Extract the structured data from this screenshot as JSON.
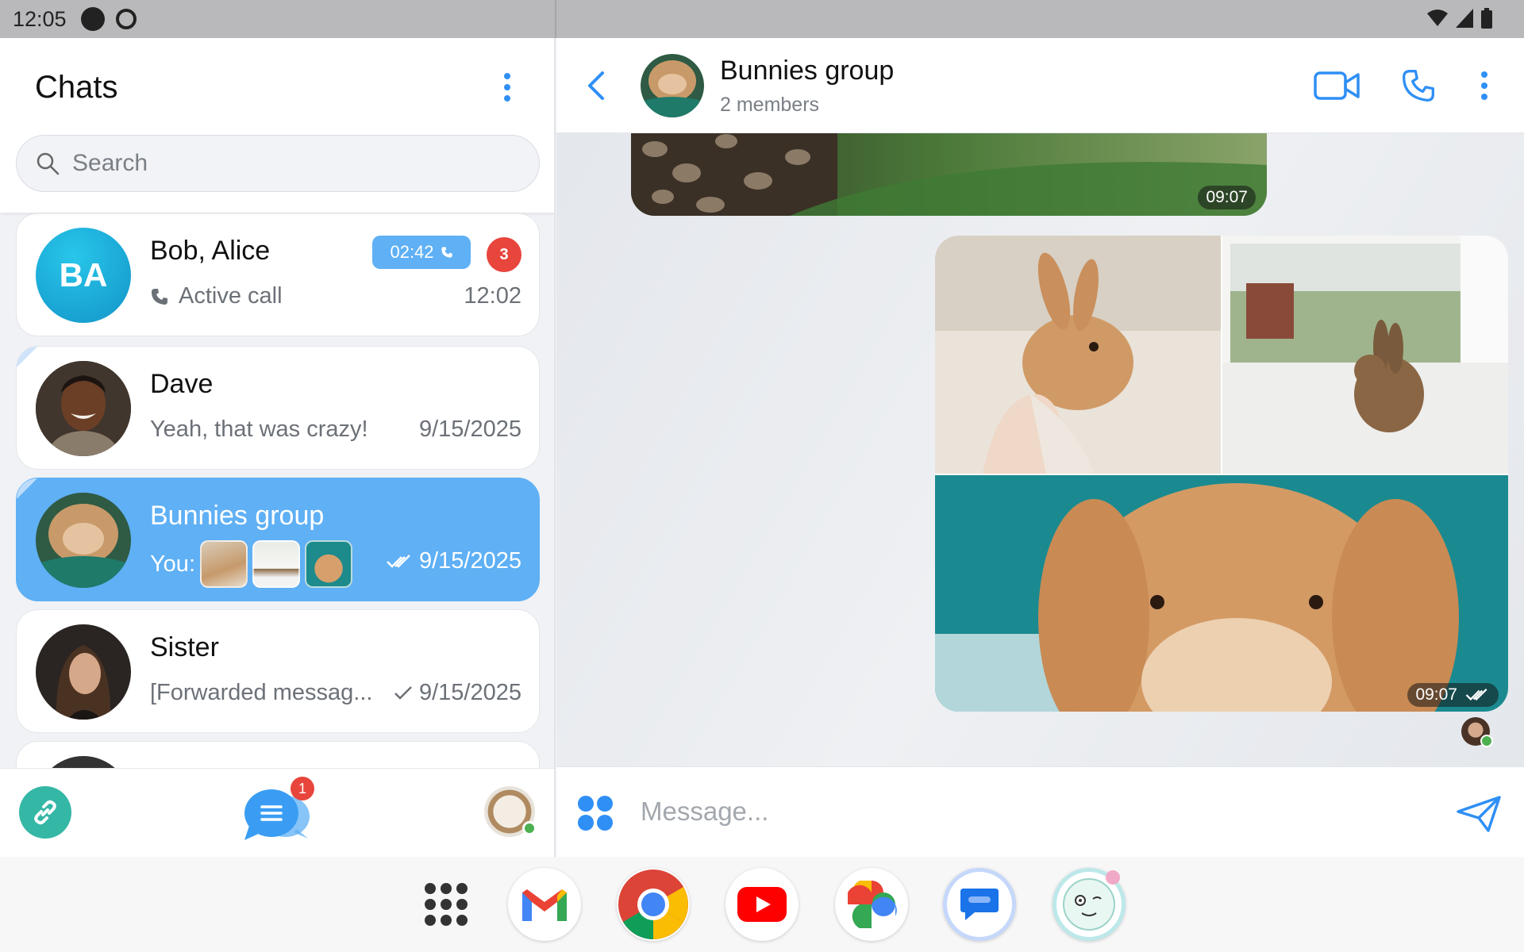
{
  "status_bar": {
    "time": "12:05"
  },
  "left": {
    "title": "Chats",
    "search_placeholder": "Search",
    "chats": [
      {
        "name": "Bob, Alice",
        "initials": "BA",
        "preview": "Active call",
        "time": "12:02",
        "call_duration": "02:42",
        "unread": "3",
        "avatar_color": "#1aa9d6"
      },
      {
        "name": "Dave",
        "preview": "Yeah, that was crazy!",
        "time": "9/15/2025"
      },
      {
        "name": "Bunnies group",
        "preview_prefix": "You:",
        "time": "9/15/2025"
      },
      {
        "name": "Sister",
        "preview": "[Forwarded messag...",
        "time": "9/15/2025"
      }
    ],
    "nav": {
      "chats_badge": "1"
    }
  },
  "conversation": {
    "title": "Bunnies group",
    "subtitle": "2 members",
    "top_image_time": "09:07",
    "grid_time": "09:07",
    "message_placeholder": "Message..."
  },
  "colors": {
    "accent": "#2f8ff5",
    "active_chat": "#5fb0f5",
    "badge": "#e8453c"
  }
}
